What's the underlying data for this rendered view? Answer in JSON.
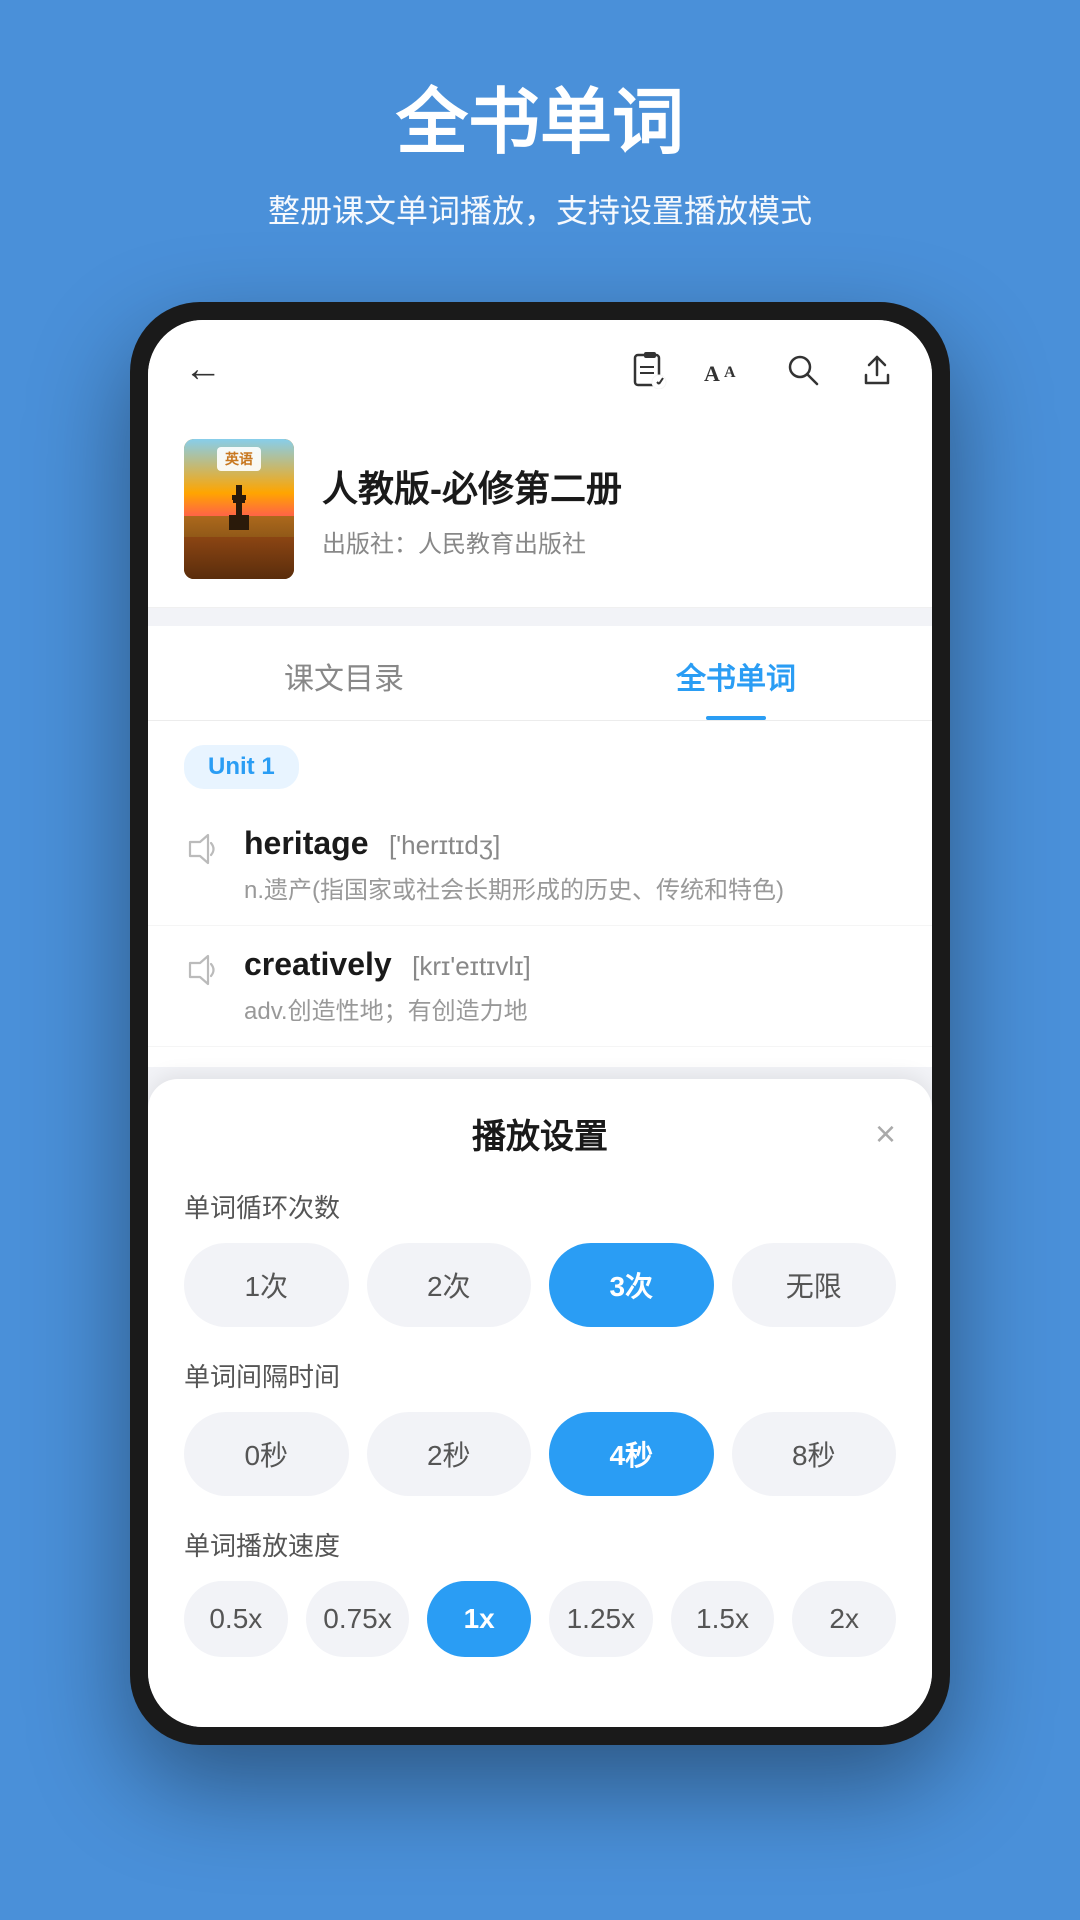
{
  "page": {
    "title": "全书单词",
    "subtitle": "整册课文单词播放，支持设置播放模式"
  },
  "nav": {
    "back": "←",
    "icons": [
      "clip-icon",
      "font-icon",
      "search-icon",
      "share-icon"
    ]
  },
  "book": {
    "title": "人教版-必修第二册",
    "publisher": "出版社：人民教育出版社",
    "cover_label": "英语"
  },
  "tabs": [
    {
      "id": "course",
      "label": "课文目录",
      "active": false
    },
    {
      "id": "vocabulary",
      "label": "全书单词",
      "active": true
    }
  ],
  "unit": {
    "label": "Unit 1"
  },
  "words": [
    {
      "english": "heritage",
      "phonetic": "['herɪtɪdʒ]",
      "meaning": "n.遗产(指国家或社会长期形成的历史、传统和特色)"
    },
    {
      "english": "creatively",
      "phonetic": "[krɪ'eɪtɪvlɪ]",
      "meaning": "adv.创造性地；有创造力地"
    }
  ],
  "settings": {
    "title": "播放设置",
    "close_label": "×",
    "sections": [
      {
        "id": "loop_count",
        "label": "单词循环次数",
        "options": [
          "1次",
          "2次",
          "3次",
          "无限"
        ],
        "active_index": 2
      },
      {
        "id": "interval",
        "label": "单词间隔时间",
        "options": [
          "0秒",
          "2秒",
          "4秒",
          "8秒"
        ],
        "active_index": 2
      },
      {
        "id": "speed",
        "label": "单词播放速度",
        "options": [
          "0.5x",
          "0.75x",
          "1x",
          "1.25x",
          "1.5x",
          "2x"
        ],
        "active_index": 2
      }
    ]
  }
}
